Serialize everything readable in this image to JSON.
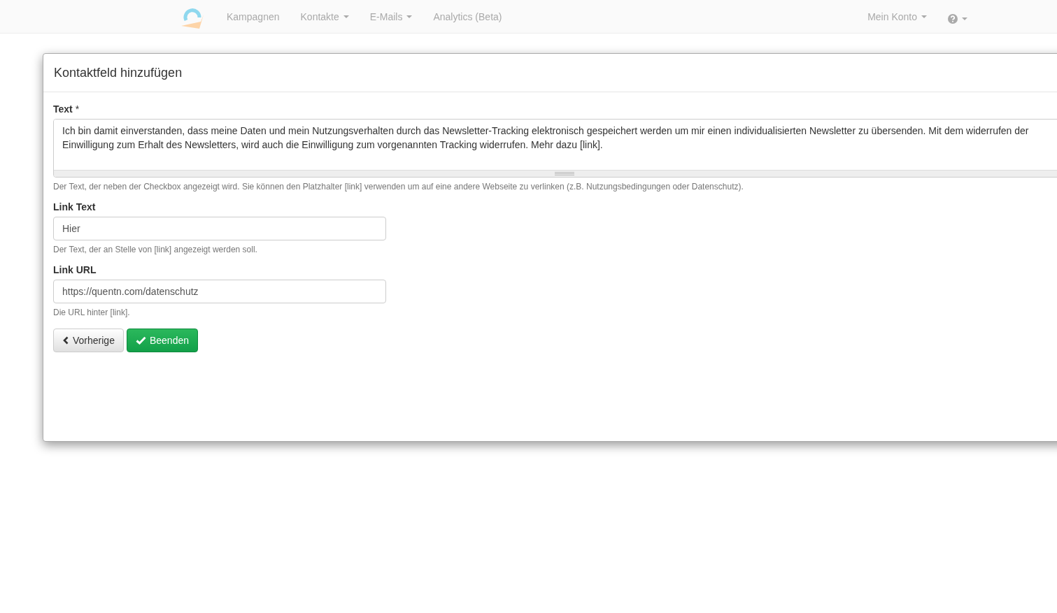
{
  "navbar": {
    "items": [
      {
        "label": "Kampagnen",
        "dropdown": false
      },
      {
        "label": "Kontakte",
        "dropdown": true
      },
      {
        "label": "E-Mails",
        "dropdown": true
      },
      {
        "label": "Analytics (Beta)",
        "dropdown": false
      }
    ],
    "right_items": [
      {
        "kind": "text",
        "label": "Mein Konto",
        "dropdown": true
      },
      {
        "kind": "help",
        "dropdown": true
      }
    ]
  },
  "modal": {
    "title": "Kontaktfeld hinzufügen",
    "fields": [
      {
        "kind": "textarea",
        "label": "Text",
        "required_mark": "*",
        "value": "Ich bin damit einverstanden, dass meine Daten und mein Nutzungsverhalten durch das Newsletter-Tracking elektronisch gespeichert werden um mir einen individualisierten Newsletter zu übersenden. Mit dem widerrufen der Einwilligung zum Erhalt des Newsletters, wird auch die Einwilligung zum vorgenannten Tracking widerrufen. Mehr dazu [link].",
        "help": "Der Text, der neben der Checkbox angezeigt wird. Sie können den Platzhalter [link] verwenden um auf eine andere Webseite zu verlinken (z.B. Nutzungsbedingungen oder Datenschutz)."
      },
      {
        "kind": "input",
        "label": "Link Text",
        "value": "Hier",
        "help": "Der Text, der an Stelle von [link] angezeigt werden soll."
      },
      {
        "kind": "input",
        "label": "Link URL",
        "value": "https://quentn.com/datenschutz",
        "help": "Die URL hinter [link]."
      }
    ],
    "buttons": [
      {
        "kind": "back",
        "label": "Vorherige"
      },
      {
        "kind": "finish",
        "label": "Beenden"
      }
    ]
  }
}
